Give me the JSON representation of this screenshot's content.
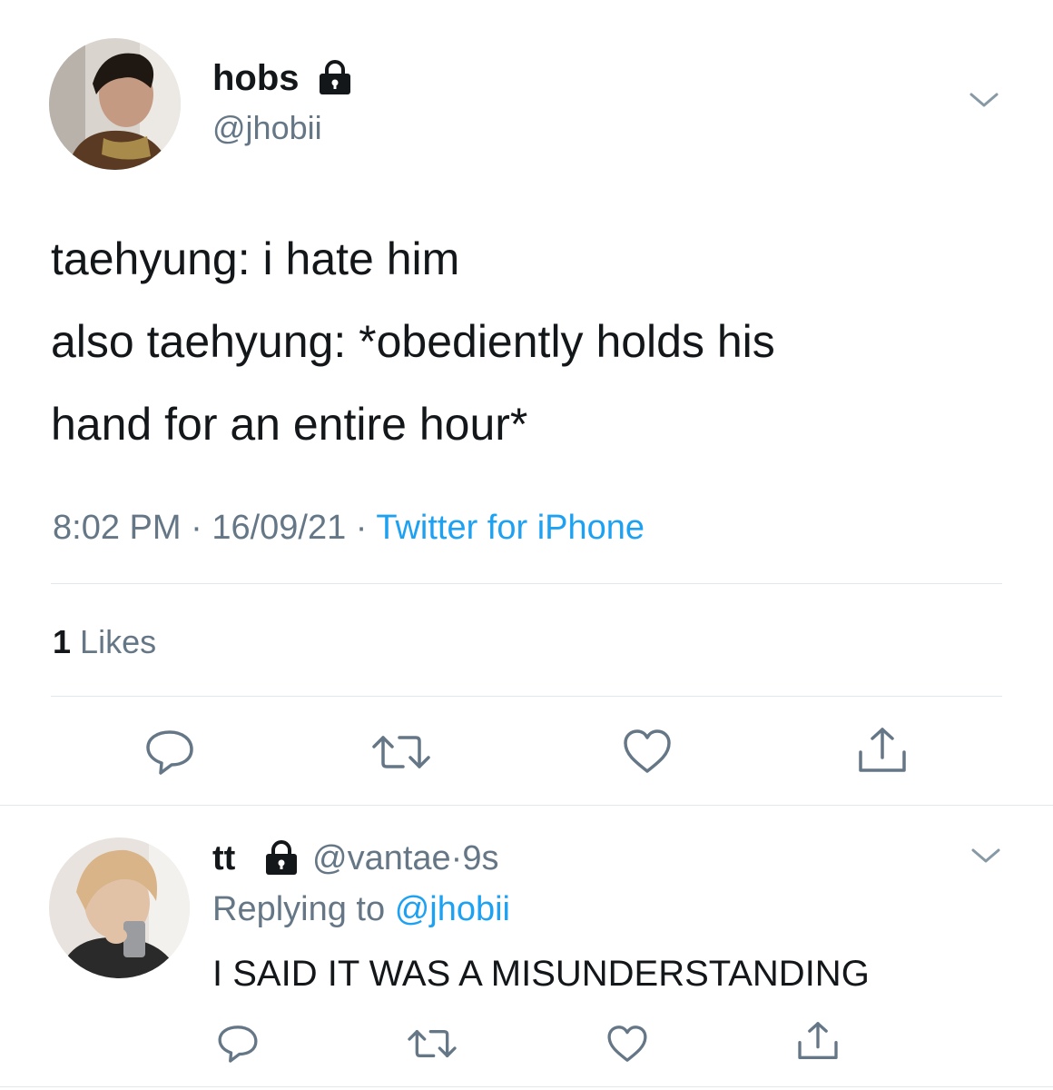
{
  "main_tweet": {
    "display_name": "hobs",
    "handle": "@jhobii",
    "text_lines": [
      "taehyung: i hate him",
      "also taehyung: *obediently holds his",
      "hand for an entire hour*"
    ],
    "time": "8:02 PM",
    "date": "16/09/21",
    "source": "Twitter for iPhone",
    "likes_count": "1",
    "likes_label": "Likes",
    "separator": "·"
  },
  "reply": {
    "display_name": "tt",
    "handle": "@vantae",
    "time_ago": "9s",
    "separator": "·",
    "replying_to_label": "Replying to",
    "replying_to_handle": "@jhobii",
    "text": "I SAID IT WAS A MISUNDERSTANDING"
  },
  "icons": [
    "lock-icon",
    "chevron-down-icon",
    "reply-icon",
    "retweet-icon",
    "like-icon",
    "share-icon"
  ],
  "colors": {
    "text": "#14171a",
    "muted": "#657786",
    "link": "#1da1f2",
    "divider": "#e1e8ed"
  }
}
